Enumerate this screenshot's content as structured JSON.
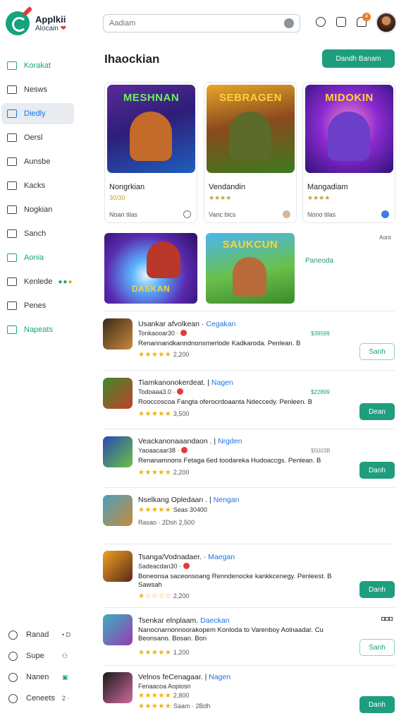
{
  "app": {
    "title": "Applkii",
    "subtitle": "Alocain"
  },
  "sidebar": {
    "items": [
      {
        "label": "Korakat"
      },
      {
        "label": "Nesws"
      },
      {
        "label": "Diedly"
      },
      {
        "label": "Oersl"
      },
      {
        "label": "Aunsbe"
      },
      {
        "label": "Kacks"
      },
      {
        "label": "Nogkian"
      },
      {
        "label": "Sanch"
      },
      {
        "label": "Aonia"
      },
      {
        "label": "Kenlede"
      },
      {
        "label": "Penes"
      },
      {
        "label": "Napeats"
      }
    ],
    "bottom": [
      {
        "label": "Ranad",
        "meta": "• D"
      },
      {
        "label": "Supe",
        "meta": ""
      },
      {
        "label": "Nanen",
        "meta": ""
      },
      {
        "label": "Ceneets",
        "meta": "2 ·"
      }
    ]
  },
  "search": {
    "placeholder": "Aadiam"
  },
  "header": {
    "badge": "4",
    "page_title": "Ihaockian",
    "primary_button": "Dandh Banam"
  },
  "featured": [
    {
      "art_label": "MESHNAN",
      "title": "Nongrkian",
      "sub": "30/30",
      "meta": "Noan tilas"
    },
    {
      "art_label": "SEBRAGEN",
      "title": "Vendandin",
      "sub": "★★★★",
      "meta": "Vanc bics"
    },
    {
      "art_label": "MIDOKIN",
      "title": "Mangadiam",
      "sub": "★★★★",
      "meta": "Nono tilas"
    }
  ],
  "promo": {
    "art_label_1": "DASKAN",
    "art_label_2": "SAUKCUN",
    "link": "Paneoda",
    "note": "Aont"
  },
  "list": [
    {
      "title": "Usankar afvolkean",
      "tag": "Cegakan",
      "line2": "Tonkaooar30 ·",
      "price": "$39599",
      "desc": "Renannandkanndnonsmerlode Kadkaroda. Penlean. B",
      "stars": "★★★★★",
      "rating": "2,200",
      "button": "Sanh"
    },
    {
      "title": "Tiamkanonokerdeat.",
      "tag": "Nagen",
      "line2": "Todoaaa3.0 ·",
      "price": "$22899",
      "desc": "Rooccoscoa Fangta oferocrdoaanta Ndeccedy. Penleen. B",
      "stars": "★★★★★",
      "rating": "3,500",
      "button": "Dean"
    },
    {
      "title": "Veackanonaaandaon .",
      "tag": "Nrgden",
      "line2": "Yaoaacaar38 ·",
      "price": "$5003B",
      "desc": "Renanamnons Fetaga 6ed toodareka Hudoaccgs. Penlean. B",
      "stars": "★★★★★",
      "rating": "2,200",
      "button": "Danh"
    },
    {
      "title": "Nselkang Opledaan .",
      "tag": "Nengan",
      "line2": "Seas 30400",
      "price": "",
      "desc": "",
      "stars": "★★★★★",
      "rating": "2,500",
      "extra": "Rasao · 2Dsh"
    },
    {
      "title": "Tsanga/Vodnadaer.",
      "tag": "Maegan",
      "line2": "Sadeacdan30 ·",
      "price": "",
      "desc": "Boneonsa saceonsoang Renndenocke kankkcenegy. Penleest. B Sawsah",
      "stars": "★☆☆☆☆",
      "rating": "2,200",
      "button": "Danh"
    },
    {
      "title": "Tsenkar elnplaam.",
      "tag": "Daeckan",
      "line2": "",
      "price": "",
      "desc": "Nanocnarnonnoorakopem Konloda to Varenboy Aolnaadar. Cu Beonsano. Bosan. Bon",
      "stars": "★★★★★",
      "rating": "1,200",
      "button": "Sanh",
      "corner": "◘◘◘"
    },
    {
      "title": "Velnos feCenagaar.",
      "tag": "Nagen",
      "line2": "Fenaacoa Aopiosn",
      "price": "",
      "desc": "",
      "stars": "★★★★★",
      "rating": "2,800",
      "rating2": "Saam · 2Bdh",
      "button": "Danh"
    }
  ]
}
